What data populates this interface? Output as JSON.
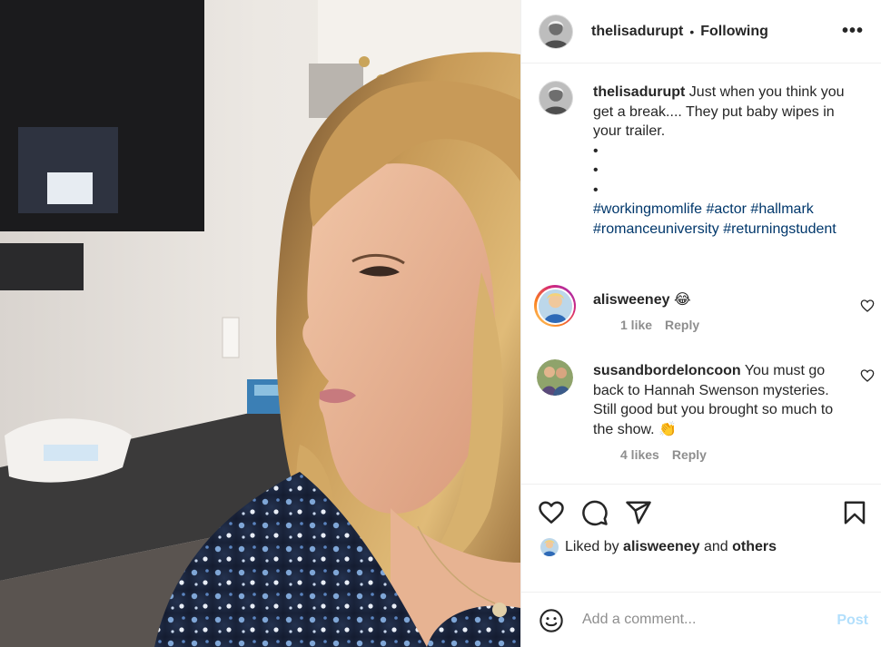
{
  "post": {
    "username": "thelisadurupt",
    "follow_status": "Following",
    "separator": "•",
    "more_icon": "more-options-icon"
  },
  "caption": {
    "username": "thelisadurupt",
    "text": "Just when you think you get a break.... They put baby wipes in your trailer.",
    "bullets": [
      "•",
      "•",
      "•"
    ],
    "hashtags": [
      "#workingmomlife",
      "#actor",
      "#hallmark",
      "#romanceuniversity",
      "#returningstudent"
    ]
  },
  "comments": [
    {
      "username": "alisweeney",
      "text": "😂",
      "likes": "1 like",
      "reply": "Reply"
    },
    {
      "username": "susandbordeloncoon",
      "text": "You must go back to Hannah Swenson mysteries. Still good but you brought so much to the show. 👏",
      "likes": "4 likes",
      "reply": "Reply"
    }
  ],
  "liked_by": {
    "prefix": "Liked by",
    "user": "alisweeney",
    "and": "and",
    "others": "others"
  },
  "add_comment": {
    "placeholder": "Add a comment...",
    "post_label": "Post"
  },
  "colors": {
    "hashtag": "#00376b",
    "meta": "#8e8e8e",
    "post_disabled": "#b2dffc"
  }
}
